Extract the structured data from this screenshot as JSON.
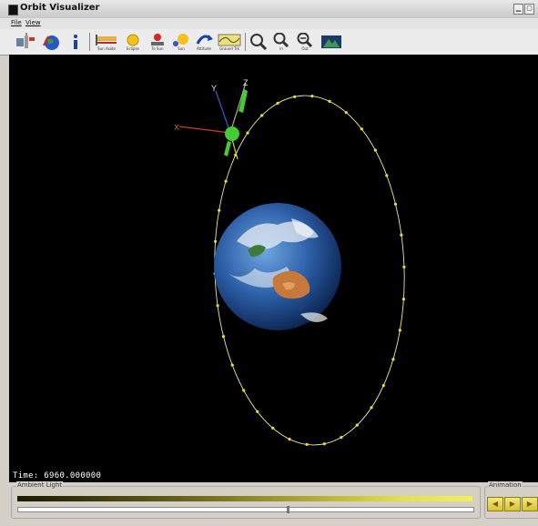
{
  "window": {
    "title": "Orbit Visualizer"
  },
  "menu": [
    {
      "label": "File"
    },
    {
      "label": "View"
    }
  ],
  "toolbar": {
    "group1": [
      {
        "icon": "satellite-icon"
      },
      {
        "icon": "earth-icon"
      },
      {
        "icon": "info-icon"
      }
    ],
    "group2": [
      {
        "icon": "sun-panel-icon",
        "label": "Sun Aside"
      },
      {
        "icon": "sun-icon",
        "label": "Eclipse"
      },
      {
        "icon": "to-sun-icon",
        "label": "To Sun"
      },
      {
        "icon": "sun-orbit-icon",
        "label": "Sun"
      },
      {
        "icon": "attitude-icon",
        "label": "Attitude"
      },
      {
        "icon": "ground-track-icon",
        "label": "Ground Trk"
      }
    ],
    "group3": [
      {
        "icon": "zoom-icon",
        "label": ""
      },
      {
        "icon": "zoom-in-icon",
        "label": "In"
      },
      {
        "icon": "zoom-out-icon",
        "label": "Out"
      },
      {
        "icon": "terrain-icon",
        "label": ""
      }
    ]
  },
  "scene": {
    "time_label": "Time: 6960.000000",
    "orbit_color": "#e8e8a0",
    "marker_color": "#f0e020",
    "satellite_color": "#44cc33",
    "axes": [
      {
        "label": "X"
      },
      {
        "label": "Y"
      },
      {
        "label": "Z"
      }
    ]
  },
  "controls": {
    "ambient_label": "Ambient Light",
    "ambient_level": 0.59,
    "animation_label": "Animation",
    "animation_buttons": [
      {
        "icon": "step-back-icon"
      },
      {
        "icon": "play-icon"
      },
      {
        "icon": "step-forward-icon"
      }
    ]
  }
}
